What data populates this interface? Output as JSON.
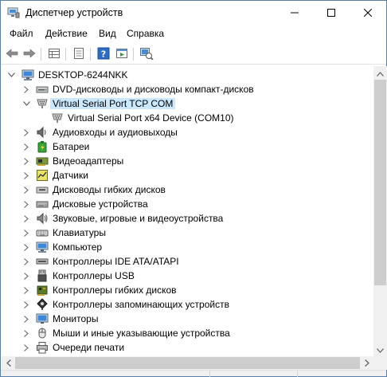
{
  "window": {
    "title": "Диспетчер устройств",
    "icon": "device-manager-icon",
    "controls": [
      "minimize-icon",
      "maximize-icon",
      "close-icon"
    ]
  },
  "menu": {
    "items": [
      "Файл",
      "Действие",
      "Вид",
      "Справка"
    ]
  },
  "toolbar": {
    "buttons": [
      "back-icon",
      "forward-icon",
      "properties-grid-icon",
      "show-hidden-icon",
      "help-icon",
      "run-icon",
      "scan-hardware-icon"
    ]
  },
  "tree": {
    "root": "DESKTOP-6244NKK",
    "items": [
      {
        "label": "DVD-дисководы и дисководы компакт-дисков",
        "icon": "dvd-drive-icon",
        "expanded": false
      },
      {
        "label": "Virtual Serial Port TCP COM",
        "icon": "serial-port-icon",
        "expanded": true,
        "selected": true
      },
      {
        "label": "Virtual Serial Port x64 Device (COM10)",
        "icon": "serial-port-icon",
        "child": true
      },
      {
        "label": "Аудиовходы и аудиовыходы",
        "icon": "speaker-icon",
        "expanded": false
      },
      {
        "label": "Батареи",
        "icon": "battery-icon",
        "expanded": false
      },
      {
        "label": "Видеоадаптеры",
        "icon": "display-adapter-icon",
        "expanded": false
      },
      {
        "label": "Датчики",
        "icon": "sensor-icon",
        "expanded": false
      },
      {
        "label": "Дисководы гибких дисков",
        "icon": "floppy-drive-icon",
        "expanded": false
      },
      {
        "label": "Дисковые устройства",
        "icon": "disk-drive-icon",
        "expanded": false
      },
      {
        "label": "Звуковые, игровые и видеоустройства",
        "icon": "sound-icon",
        "expanded": false
      },
      {
        "label": "Клавиатуры",
        "icon": "keyboard-icon",
        "expanded": false
      },
      {
        "label": "Компьютер",
        "icon": "computer-icon",
        "expanded": false
      },
      {
        "label": "Контроллеры IDE ATA/ATAPI",
        "icon": "ide-controller-icon",
        "expanded": false
      },
      {
        "label": "Контроллеры USB",
        "icon": "usb-icon",
        "expanded": false
      },
      {
        "label": "Контроллеры гибких дисков",
        "icon": "floppy-controller-icon",
        "expanded": false
      },
      {
        "label": "Контроллеры запоминающих устройств",
        "icon": "storage-controller-icon",
        "expanded": false
      },
      {
        "label": "Мониторы",
        "icon": "monitor-icon",
        "expanded": false
      },
      {
        "label": "Мыши и иные указывающие устройства",
        "icon": "mouse-icon",
        "expanded": false
      },
      {
        "label": "Очереди печати",
        "icon": "printer-icon",
        "expanded": false
      }
    ]
  },
  "colors": {
    "selection": "#cce8ff",
    "border": "#5a7fa8",
    "chrome": "#f0f0f0"
  }
}
